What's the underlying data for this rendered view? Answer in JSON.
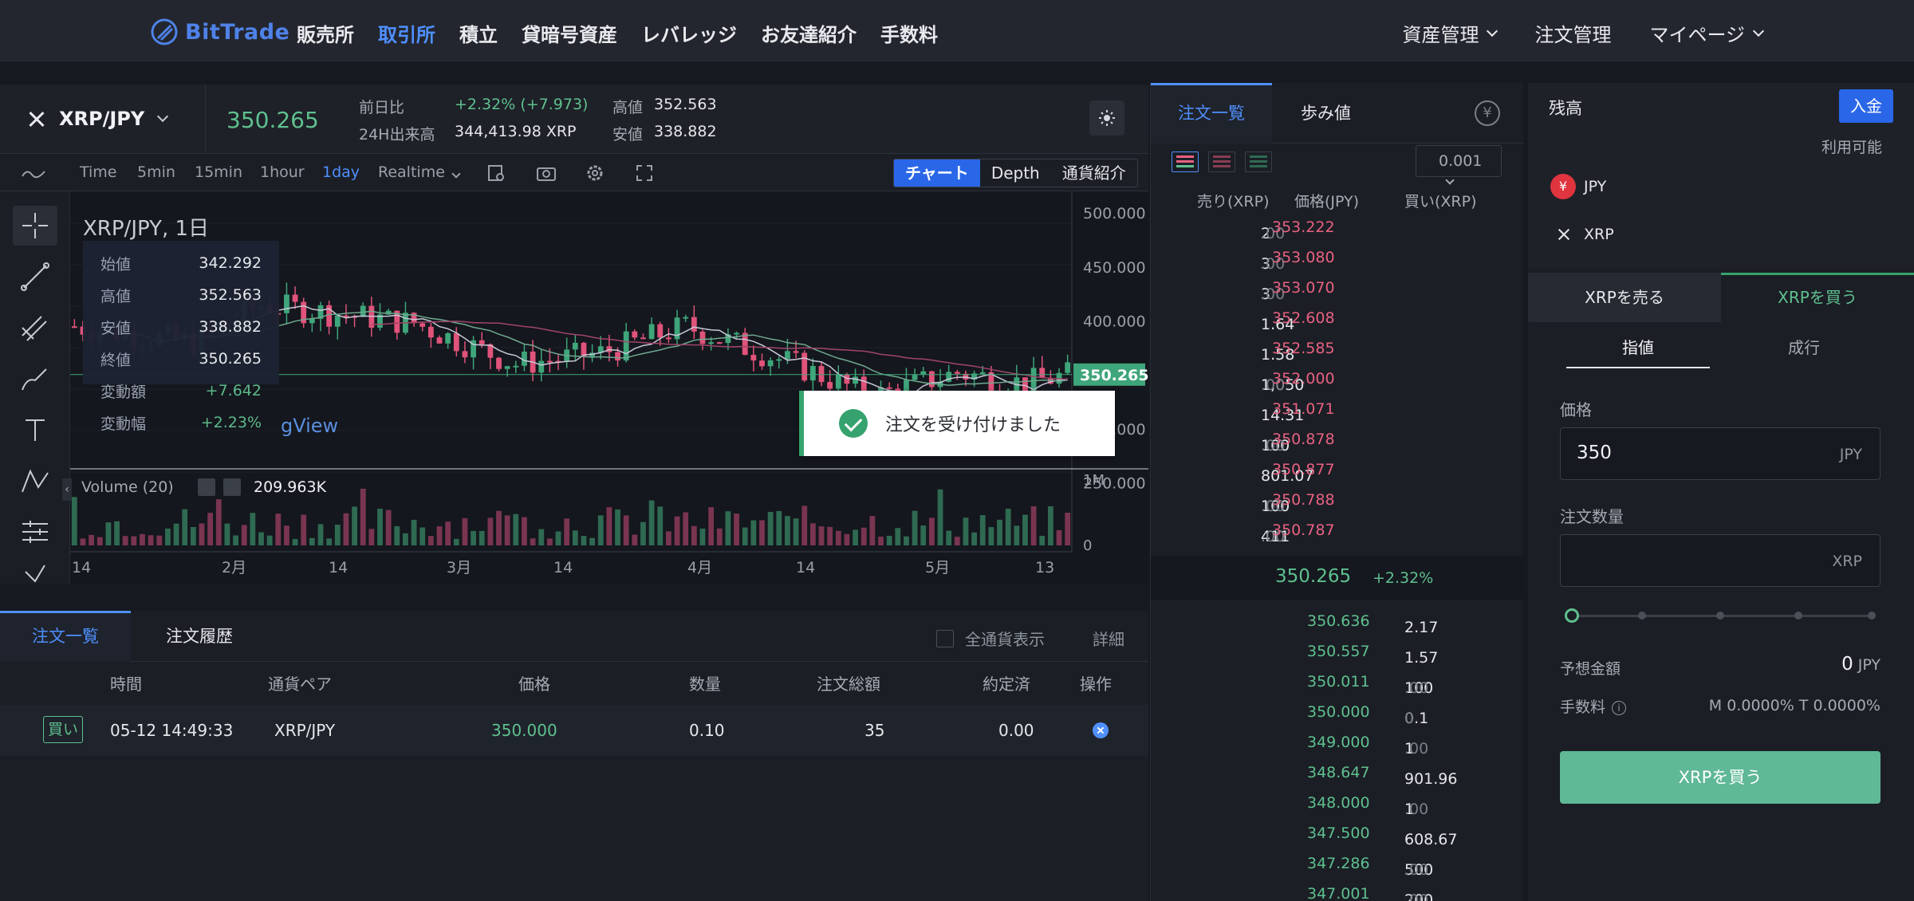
{
  "brand": {
    "name": "BitTrade",
    "accent": "#4f82e8"
  },
  "nav": {
    "links": [
      "販売所",
      "取引所",
      "積立",
      "貸暗号資産",
      "レバレッジ",
      "お友達紹介",
      "手数料"
    ],
    "active_index": 1,
    "right": [
      "資産管理",
      "注文管理",
      "マイページ"
    ]
  },
  "ticker": {
    "pair": "XRP/JPY",
    "last": "350.265",
    "change_label": "前日比",
    "change_value": "+2.32% (+7.973)",
    "volume_label": "24H出来高",
    "volume_value": "344,413.98 XRP",
    "high_label": "高値",
    "high_value": "352.563",
    "low_label": "安値",
    "low_value": "338.882"
  },
  "chart_toolbar": {
    "intervals": [
      "Time",
      "5min",
      "15min",
      "1hour",
      "1day",
      "Realtime"
    ],
    "active_interval": "1day",
    "views": [
      "チャート",
      "Depth",
      "通貨紹介"
    ],
    "active_view": "チャート"
  },
  "chart": {
    "title": "XRP/JPY, 1日",
    "ohlc": [
      {
        "k": "始値",
        "v": "342.292",
        "green": false
      },
      {
        "k": "高値",
        "v": "352.563",
        "green": false
      },
      {
        "k": "安値",
        "v": "338.882",
        "green": false
      },
      {
        "k": "終値",
        "v": "350.265",
        "green": false
      },
      {
        "k": "変動額",
        "v": "+7.642",
        "green": true
      },
      {
        "k": "変動幅",
        "v": "+2.23%",
        "green": true
      }
    ],
    "watermark": "gView",
    "volume_label": "Volume (20)",
    "volume_value": "209.963K",
    "price_badge": "350.265",
    "y_ticks": [
      "500.000",
      "450.000",
      "400.000",
      "350.000",
      "300.000",
      "250.000"
    ],
    "vol_ticks": [
      "1M",
      "0"
    ],
    "x_ticks": [
      "14",
      "2月",
      "14",
      "3月",
      "14",
      "4月",
      "14",
      "5月",
      "13"
    ]
  },
  "chart_data": {
    "type": "candlestick",
    "title": "XRP/JPY, 1日",
    "ylim": [
      260,
      520
    ],
    "last_price": 350.265,
    "ma_series": [
      "MA short",
      "MA mid",
      "MA long"
    ],
    "x_ticks": [
      "14",
      "2月",
      "14",
      "3月",
      "14",
      "4月",
      "14",
      "5月",
      "13"
    ]
  },
  "toast": {
    "text": "注文を受け付けました"
  },
  "orders": {
    "tabs": [
      "注文一覧",
      "注文履歴"
    ],
    "all_currency": "全通貨表示",
    "detail": "詳細",
    "headers": [
      "時間",
      "通貨ペア",
      "価格",
      "数量",
      "注文総額",
      "約定済",
      "操作"
    ],
    "rows": [
      {
        "side": "買い",
        "time": "05-12 14:49:33",
        "pair": "XRP/JPY",
        "price": "350.000",
        "qty": "0.10",
        "total": "35",
        "filled": "0.00"
      }
    ]
  },
  "book": {
    "tabs": [
      "注文一覧",
      "歩み値"
    ],
    "precision": "0.001",
    "headers": [
      "売り(XRP)",
      "価格(JPY)",
      "買い(XRP)"
    ],
    "asks": [
      {
        "amt": "2",
        "dec": ".00",
        "price": "353.222"
      },
      {
        "amt": "3",
        "dec": ".00",
        "price": "353.080"
      },
      {
        "amt": "3",
        "dec": ".00",
        "price": "353.070"
      },
      {
        "amt": "1.64",
        "dec": "",
        "price": "352.608"
      },
      {
        "amt": "1.58",
        "dec": "",
        "price": "352.585"
      },
      {
        "amt": "1,050",
        "dec": ".00",
        "price": "352.000"
      },
      {
        "amt": "14.31",
        "dec": "",
        "price": "351.071"
      },
      {
        "amt": "100",
        "dec": ".00",
        "price": "350.878"
      },
      {
        "amt": "801.07",
        "dec": "",
        "price": "350.877"
      },
      {
        "amt": "100",
        "dec": ".00",
        "price": "350.788"
      },
      {
        "amt": "411",
        "dec": ".00",
        "price": "350.787"
      }
    ],
    "mid_price": "350.265",
    "mid_change": "+2.32%",
    "bids": [
      {
        "price": "350.636",
        "amt": "2.17",
        "dec": ""
      },
      {
        "price": "350.557",
        "amt": "1.57",
        "dec": ""
      },
      {
        "price": "350.011",
        "amt": "100",
        "dec": ".00"
      },
      {
        "price": "350.000",
        "amt": "0.1",
        "dec": "0"
      },
      {
        "price": "349.000",
        "amt": "1",
        "dec": ".00"
      },
      {
        "price": "348.647",
        "amt": "901.96",
        "dec": ""
      },
      {
        "price": "348.000",
        "amt": "1",
        "dec": ".00"
      },
      {
        "price": "347.500",
        "amt": "608.67",
        "dec": ""
      },
      {
        "price": "347.286",
        "amt": "500",
        "dec": ".00"
      },
      {
        "price": "347.001",
        "amt": "200",
        "dec": ".00"
      }
    ]
  },
  "trade": {
    "balance_title": "残高",
    "deposit": "入金",
    "available": "利用可能",
    "coins": [
      "JPY",
      "XRP"
    ],
    "sell_tab": "XRPを売る",
    "buy_tab": "XRPを買う",
    "type_limit": "指値",
    "type_market": "成行",
    "price_label": "価格",
    "price_value": "350",
    "price_unit": "JPY",
    "qty_label": "注文数量",
    "qty_value": "",
    "qty_unit": "XRP",
    "est_label": "予想金額",
    "est_value": "0",
    "est_unit": "JPY",
    "fee_label": "手数料",
    "fee_value": "M 0.0000% T 0.0000%",
    "buy_button": "XRPを買う",
    "slider_percent": 0
  }
}
